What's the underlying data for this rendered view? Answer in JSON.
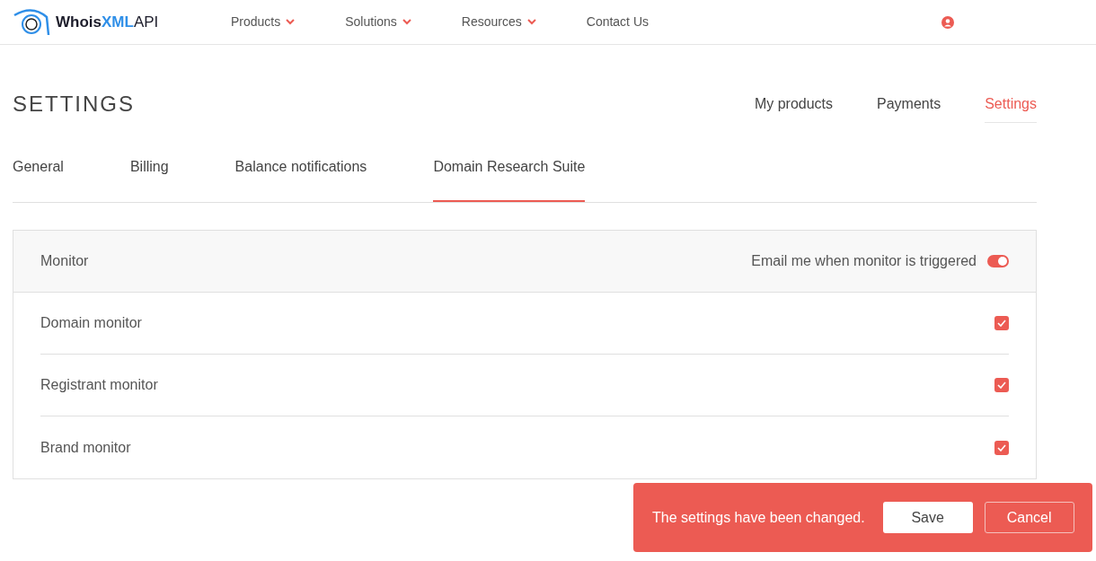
{
  "header": {
    "logo": [
      "Whois",
      "XML",
      "API"
    ],
    "nav": [
      {
        "label": "Products",
        "dropdown": true
      },
      {
        "label": "Solutions",
        "dropdown": true
      },
      {
        "label": "Resources",
        "dropdown": true
      },
      {
        "label": "Contact Us",
        "dropdown": false
      }
    ]
  },
  "page_title": "SETTINGS",
  "page_tabs": [
    {
      "label": "My products",
      "selected": false
    },
    {
      "label": "Payments",
      "selected": false
    },
    {
      "label": "Settings",
      "selected": true
    }
  ],
  "settings_tabs": [
    {
      "label": "General",
      "selected": false
    },
    {
      "label": "Billing",
      "selected": false
    },
    {
      "label": "Balance notifications",
      "selected": false
    },
    {
      "label": "Domain Research Suite",
      "selected": true
    }
  ],
  "panel": {
    "title": "Monitor",
    "toggle_label": "Email me when monitor is triggered",
    "toggle_on": true,
    "rows": [
      {
        "label": "Domain monitor",
        "checked": true
      },
      {
        "label": "Registrant monitor",
        "checked": true
      },
      {
        "label": "Brand monitor",
        "checked": true
      }
    ]
  },
  "notice": {
    "message": "The settings have been changed.",
    "save": "Save",
    "cancel": "Cancel"
  }
}
